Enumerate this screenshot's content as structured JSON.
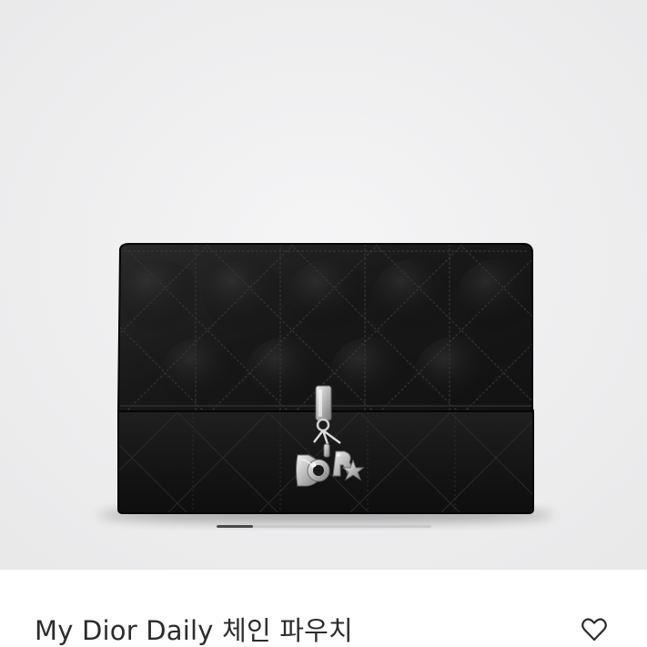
{
  "product": {
    "title": "My Dior Daily 체인 파우치"
  },
  "gallery": {
    "image_subject": "black cannage-quilted leather chain pouch with silver Dior charms",
    "progress": 0.17
  },
  "icons": {
    "like": "heart-icon"
  },
  "colors": {
    "background": "#eeeeef",
    "bag": "#141414",
    "hardware": "#c9c9c9",
    "text": "#2c2c2c",
    "pager_track": "#c9c9cc",
    "pager_fill": "#4a4a4d"
  }
}
